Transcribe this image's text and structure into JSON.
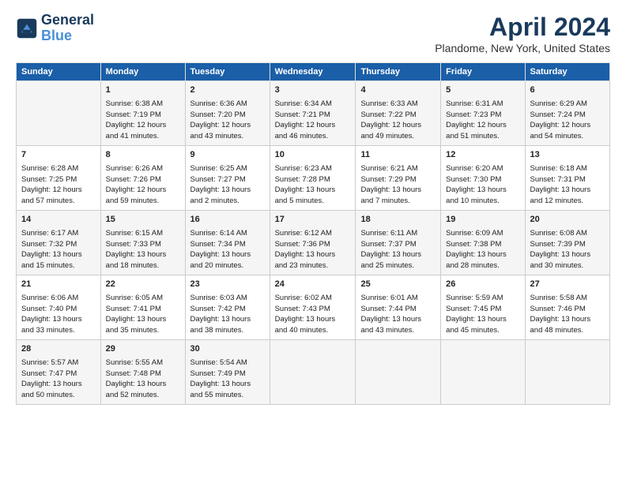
{
  "header": {
    "logo_line1": "General",
    "logo_line2": "Blue",
    "month": "April 2024",
    "location": "Plandome, New York, United States"
  },
  "days_of_week": [
    "Sunday",
    "Monday",
    "Tuesday",
    "Wednesday",
    "Thursday",
    "Friday",
    "Saturday"
  ],
  "weeks": [
    [
      {
        "day": "",
        "info": ""
      },
      {
        "day": "1",
        "info": "Sunrise: 6:38 AM\nSunset: 7:19 PM\nDaylight: 12 hours\nand 41 minutes."
      },
      {
        "day": "2",
        "info": "Sunrise: 6:36 AM\nSunset: 7:20 PM\nDaylight: 12 hours\nand 43 minutes."
      },
      {
        "day": "3",
        "info": "Sunrise: 6:34 AM\nSunset: 7:21 PM\nDaylight: 12 hours\nand 46 minutes."
      },
      {
        "day": "4",
        "info": "Sunrise: 6:33 AM\nSunset: 7:22 PM\nDaylight: 12 hours\nand 49 minutes."
      },
      {
        "day": "5",
        "info": "Sunrise: 6:31 AM\nSunset: 7:23 PM\nDaylight: 12 hours\nand 51 minutes."
      },
      {
        "day": "6",
        "info": "Sunrise: 6:29 AM\nSunset: 7:24 PM\nDaylight: 12 hours\nand 54 minutes."
      }
    ],
    [
      {
        "day": "7",
        "info": "Sunrise: 6:28 AM\nSunset: 7:25 PM\nDaylight: 12 hours\nand 57 minutes."
      },
      {
        "day": "8",
        "info": "Sunrise: 6:26 AM\nSunset: 7:26 PM\nDaylight: 12 hours\nand 59 minutes."
      },
      {
        "day": "9",
        "info": "Sunrise: 6:25 AM\nSunset: 7:27 PM\nDaylight: 13 hours\nand 2 minutes."
      },
      {
        "day": "10",
        "info": "Sunrise: 6:23 AM\nSunset: 7:28 PM\nDaylight: 13 hours\nand 5 minutes."
      },
      {
        "day": "11",
        "info": "Sunrise: 6:21 AM\nSunset: 7:29 PM\nDaylight: 13 hours\nand 7 minutes."
      },
      {
        "day": "12",
        "info": "Sunrise: 6:20 AM\nSunset: 7:30 PM\nDaylight: 13 hours\nand 10 minutes."
      },
      {
        "day": "13",
        "info": "Sunrise: 6:18 AM\nSunset: 7:31 PM\nDaylight: 13 hours\nand 12 minutes."
      }
    ],
    [
      {
        "day": "14",
        "info": "Sunrise: 6:17 AM\nSunset: 7:32 PM\nDaylight: 13 hours\nand 15 minutes."
      },
      {
        "day": "15",
        "info": "Sunrise: 6:15 AM\nSunset: 7:33 PM\nDaylight: 13 hours\nand 18 minutes."
      },
      {
        "day": "16",
        "info": "Sunrise: 6:14 AM\nSunset: 7:34 PM\nDaylight: 13 hours\nand 20 minutes."
      },
      {
        "day": "17",
        "info": "Sunrise: 6:12 AM\nSunset: 7:36 PM\nDaylight: 13 hours\nand 23 minutes."
      },
      {
        "day": "18",
        "info": "Sunrise: 6:11 AM\nSunset: 7:37 PM\nDaylight: 13 hours\nand 25 minutes."
      },
      {
        "day": "19",
        "info": "Sunrise: 6:09 AM\nSunset: 7:38 PM\nDaylight: 13 hours\nand 28 minutes."
      },
      {
        "day": "20",
        "info": "Sunrise: 6:08 AM\nSunset: 7:39 PM\nDaylight: 13 hours\nand 30 minutes."
      }
    ],
    [
      {
        "day": "21",
        "info": "Sunrise: 6:06 AM\nSunset: 7:40 PM\nDaylight: 13 hours\nand 33 minutes."
      },
      {
        "day": "22",
        "info": "Sunrise: 6:05 AM\nSunset: 7:41 PM\nDaylight: 13 hours\nand 35 minutes."
      },
      {
        "day": "23",
        "info": "Sunrise: 6:03 AM\nSunset: 7:42 PM\nDaylight: 13 hours\nand 38 minutes."
      },
      {
        "day": "24",
        "info": "Sunrise: 6:02 AM\nSunset: 7:43 PM\nDaylight: 13 hours\nand 40 minutes."
      },
      {
        "day": "25",
        "info": "Sunrise: 6:01 AM\nSunset: 7:44 PM\nDaylight: 13 hours\nand 43 minutes."
      },
      {
        "day": "26",
        "info": "Sunrise: 5:59 AM\nSunset: 7:45 PM\nDaylight: 13 hours\nand 45 minutes."
      },
      {
        "day": "27",
        "info": "Sunrise: 5:58 AM\nSunset: 7:46 PM\nDaylight: 13 hours\nand 48 minutes."
      }
    ],
    [
      {
        "day": "28",
        "info": "Sunrise: 5:57 AM\nSunset: 7:47 PM\nDaylight: 13 hours\nand 50 minutes."
      },
      {
        "day": "29",
        "info": "Sunrise: 5:55 AM\nSunset: 7:48 PM\nDaylight: 13 hours\nand 52 minutes."
      },
      {
        "day": "30",
        "info": "Sunrise: 5:54 AM\nSunset: 7:49 PM\nDaylight: 13 hours\nand 55 minutes."
      },
      {
        "day": "",
        "info": ""
      },
      {
        "day": "",
        "info": ""
      },
      {
        "day": "",
        "info": ""
      },
      {
        "day": "",
        "info": ""
      }
    ]
  ]
}
